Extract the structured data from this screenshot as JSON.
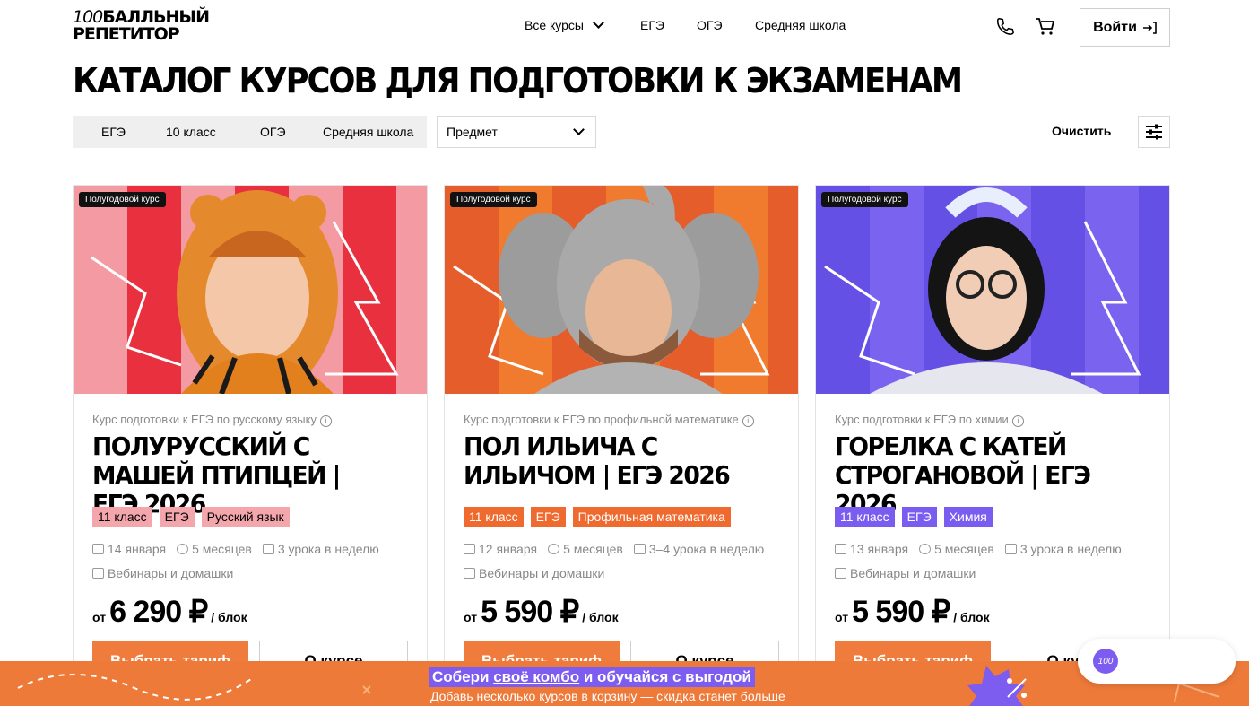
{
  "header": {
    "logo_line1_num": "100",
    "logo_line1_text": "БАЛЛЬНЫЙ",
    "logo_line2": "РЕПЕТИТОР",
    "nav": [
      "Все курсы",
      "ЕГЭ",
      "ОГЭ",
      "Средняя школа"
    ],
    "login_label": "Войти"
  },
  "page_title": "КАТАЛОГ КУРСОВ ДЛЯ ПОДГОТОВКИ К ЭКЗАМЕНАМ",
  "filters": {
    "tabs": [
      "ЕГЭ",
      "10 класс",
      "ОГЭ",
      "Средняя школа"
    ],
    "subject_label": "Предмет",
    "clear_label": "Очистить"
  },
  "cards": [
    {
      "badge": "Полугодовой курс",
      "type": "Курс подготовки к ЕГЭ по русскому языку",
      "title": "ПОЛУРУССКИЙ С МАШЕЙ ПТИПЦЕЙ | ЕГЭ 2026",
      "tags": [
        "11 класс",
        "ЕГЭ",
        "Русский язык"
      ],
      "start": "14 января",
      "duration": "5 месяцев",
      "lessons": "3 урока в неделю",
      "format": "Вебинары и домашки",
      "price_from": "от",
      "price": "6 290 ₽",
      "price_per": "/ блок",
      "btn_primary": "Выбрать тариф",
      "btn_secondary": "О курсе",
      "accent": "#f4a6ad",
      "bg": "#e8303f"
    },
    {
      "badge": "Полугодовой курс",
      "type": "Курс подготовки к ЕГЭ по профильной математике",
      "title": "ПОЛ ИЛЬИЧА С ИЛЬИЧОМ | ЕГЭ 2026",
      "tags": [
        "11 класс",
        "ЕГЭ",
        "Профильная математика"
      ],
      "start": "12 января",
      "duration": "5 месяцев",
      "lessons": "3–4 урока в неделю",
      "format": "Вебинары и домашки",
      "price_from": "от",
      "price": "5 590 ₽",
      "price_per": "/ блок",
      "btn_primary": "Выбрать тариф",
      "btn_secondary": "О курсе",
      "accent": "#ee6a2f",
      "bg": "#f07a2e"
    },
    {
      "badge": "Полугодовой курс",
      "type": "Курс подготовки к ЕГЭ по химии",
      "title": "ГОРЕЛКА С КАТЕЙ СТРОГАНОВОЙ | ЕГЭ 2026",
      "tags": [
        "11 класс",
        "ЕГЭ",
        "Химия"
      ],
      "start": "13 января",
      "duration": "5 месяцев",
      "lessons": "3 урока в неделю",
      "format": "Вебинары и домашки",
      "price_from": "от",
      "price": "5 590 ₽",
      "price_per": "/ блок",
      "btn_primary": "Выбрать тариф",
      "btn_secondary": "О курсе",
      "accent": "#7b5cf0",
      "bg": "#7a63ef"
    }
  ],
  "banner": {
    "pre": "Собери ",
    "link": "своё комбо",
    "post": " и обучайся с выгодой",
    "sub": "Добавь несколько курсов в корзину — скидка станет больше"
  },
  "chat": {
    "badge": "100"
  }
}
